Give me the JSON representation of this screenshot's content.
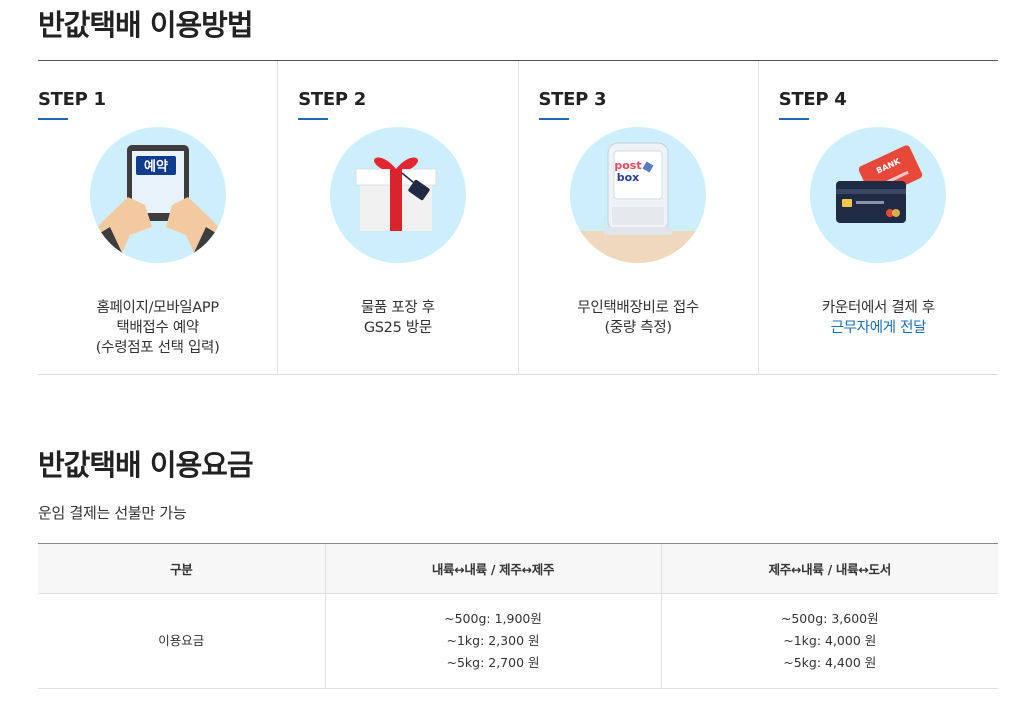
{
  "how": {
    "title": "반값택배 이용방법",
    "steps": [
      {
        "label": "STEP 1",
        "lines": [
          "홈페이지/모바일APP",
          "택배접수 예약",
          "(수령점포 선택 입력)"
        ],
        "icon": "tablet-reservation-icon",
        "badge": "예약"
      },
      {
        "label": "STEP 2",
        "lines": [
          "물품 포장 후",
          "GS25 방문"
        ],
        "icon": "gift-box-icon"
      },
      {
        "label": "STEP 3",
        "lines": [
          "무인택배장비로 접수",
          "(중량 측정)"
        ],
        "icon": "postbox-kiosk-icon",
        "brand_top": "post",
        "brand_bottom": "box"
      },
      {
        "label": "STEP 4",
        "lines": [
          "카운터에서 결제 후"
        ],
        "highlight": "근무자에게 전달",
        "icon": "bank-card-icon",
        "card_text": "BANK"
      }
    ]
  },
  "fee": {
    "title": "반값택배 이용요금",
    "note": "운임 결제는 선불만 가능",
    "headers": [
      "구분",
      "내륙↔내륙 / 제주↔제주",
      "제주↔내륙 / 내륙↔도서"
    ],
    "row_label": "이용요금",
    "col1": [
      "~500g: 1,900원",
      "~1kg: 2,300 원",
      "~5kg: 2,700 원"
    ],
    "col2": [
      "~500g: 3,600원",
      "~1kg: 4,000 원",
      "~5kg: 4,400 원"
    ]
  },
  "colors": {
    "accent": "#1e6ab0",
    "circle_bg": "#cdeefb",
    "highlight": "#1d6fb5"
  }
}
